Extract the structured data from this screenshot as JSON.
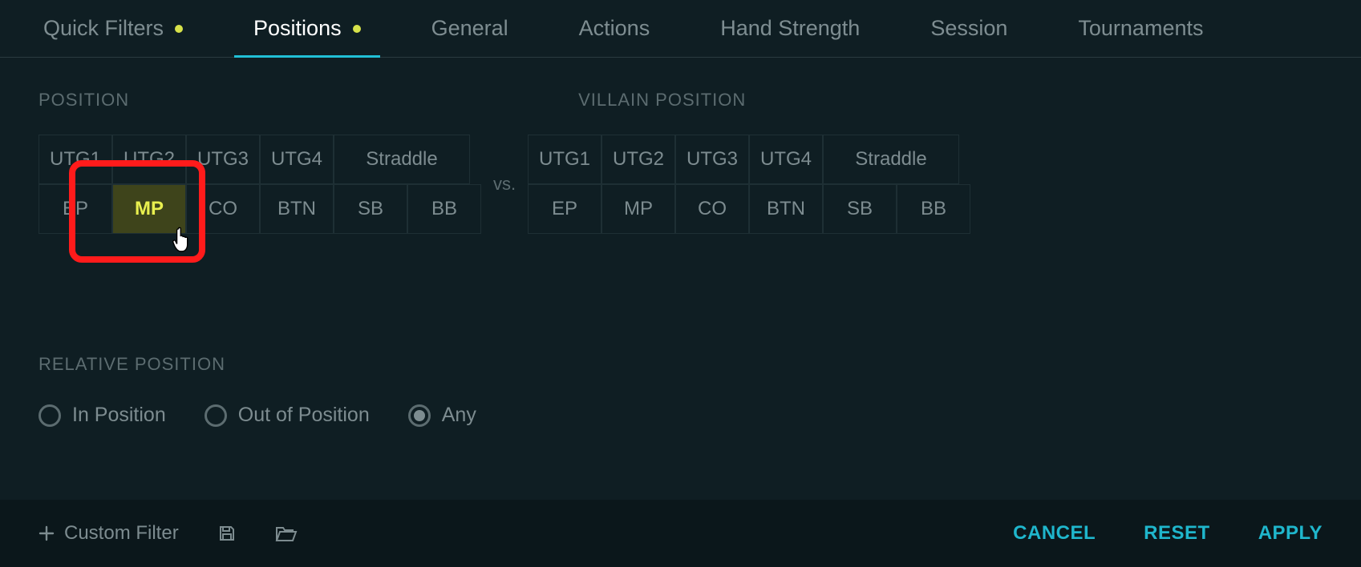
{
  "tabs": {
    "quick_filters": "Quick Filters",
    "positions": "Positions",
    "general": "General",
    "actions": "Actions",
    "hand_strength": "Hand Strength",
    "session": "Session",
    "tournaments": "Tournaments"
  },
  "labels": {
    "position": "POSITION",
    "villain_position": "VILLAIN POSITION",
    "vs": "vs.",
    "relative_position": "RELATIVE POSITION"
  },
  "hero_positions_row1": [
    "UTG1",
    "UTG2",
    "UTG3",
    "UTG4",
    "Straddle"
  ],
  "hero_positions_row2": [
    "EP",
    "MP",
    "CO",
    "BTN",
    "SB",
    "BB"
  ],
  "villain_positions_row1": [
    "UTG1",
    "UTG2",
    "UTG3",
    "UTG4",
    "Straddle"
  ],
  "villain_positions_row2": [
    "EP",
    "MP",
    "CO",
    "BTN",
    "SB",
    "BB"
  ],
  "selected_hero_position": "MP",
  "relative": {
    "in_position": "In Position",
    "out_of_position": "Out of Position",
    "any": "Any",
    "selected": "Any"
  },
  "footer": {
    "custom_filter": "Custom Filter",
    "cancel": "CANCEL",
    "reset": "RESET",
    "apply": "APPLY"
  }
}
